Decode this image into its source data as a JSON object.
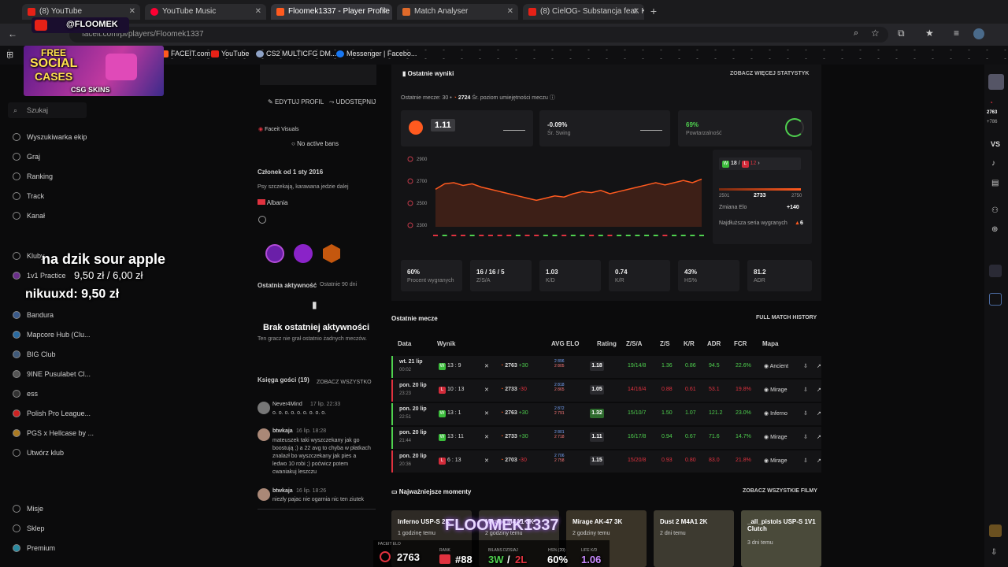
{
  "tabs": [
    {
      "label": "(8) YouTube",
      "icon": "youtube-icon"
    },
    {
      "label": "YouTube Music",
      "icon": "youtube-music-icon"
    },
    {
      "label": "Floomek1337 - Player Profile -",
      "icon": "faceit-icon"
    },
    {
      "label": "Match Analyser",
      "icon": "match-analyser-icon"
    },
    {
      "label": "(8) CielOG- Substancja feat. Ki",
      "icon": "youtube-icon"
    }
  ],
  "address": {
    "url": "faceit.com/pl/players/Floomek1337"
  },
  "bookmarks": [
    "FACEIT.com",
    "YouTube",
    "CS2 MULTICFG DM...",
    "Messenger | Facebo..."
  ],
  "overlay": {
    "channel": "@FLOOMEK",
    "ad_free": "FREE",
    "ad_social": "SOCIAL",
    "ad_cases": "CASES",
    "ad_brand": "CSG SKINS",
    "donation1_title": "na dzik sour apple",
    "donation1_amount": "9,50 zł / 6,00 zł",
    "donation2": "nikuuxd: 9,50 zł",
    "nick": "FLOOMEK1337",
    "bottom_labels": [
      "FACEIT ELO",
      "RANK",
      "BILANS DZISIAJ",
      "HS% (20)",
      "LIFE K/D"
    ],
    "bottom_values": [
      "2763",
      "#88",
      "3W",
      "2L",
      "60%",
      "1.06"
    ]
  },
  "leftnav": {
    "search": "Szukaj",
    "items": [
      "Wyszukiwarka ekip",
      "Graj",
      "Ranking",
      "Track",
      "Kanał",
      "Kluby",
      "1v1 Practice",
      "Bandura",
      "Mapcore Hub (Clu...",
      "BIG Club",
      "9INE Pusulabet Cl...",
      "ess",
      "Polish Pro League...",
      "PGS x Hellcase by ...",
      "Utwórz klub",
      "Misje",
      "Sklep",
      "Premium"
    ]
  },
  "profile": {
    "edit": "EDYTUJ PROFIL",
    "share": "UDOSTĘPNIJ",
    "visuals": "Faceit Visuals",
    "bans": "No active bans",
    "member": "Członek od 1 sty 2016",
    "bio": "Psy szczekają, karawana jedzie dalej",
    "country": "Albania",
    "activity_title": "Ostatnia aktywność",
    "activity_range": "Ostatnie 90 dni",
    "no_activity": "Brak ostatniej aktywności",
    "no_activity_sub": "Ten gracz nie grał ostatnio żadnych meczów.",
    "guestbook": "Księga gości (19)",
    "see_all": "ZOBACZ WSZYSTKO",
    "comments": [
      {
        "author": "Never4Mind",
        "date": "17 lip. 22:33",
        "text": "o. o. o. o. o. o. o. o. o."
      },
      {
        "author": "btwkaja",
        "date": "16 lip. 18:28",
        "text": "mateuszek taki wyszczekany jak go boostują ;) a 22 avg to chyba w płatkach znalazł bo wyszczekany jak pies a ledwo 10 robi ;) poćwicz potem cwaniakuj leszczu"
      },
      {
        "author": "btwkaja",
        "date": "16 lip. 18:26",
        "text": "niezły pajac nie ogarnia nic ten ziutek"
      }
    ]
  },
  "stats": {
    "title": "Ostatnie wyniki",
    "more": "ZOBACZ WIĘCEJ STATYSTYK",
    "subtitle": "Ostatnie mecze: 30 •",
    "skill_value": "2724",
    "skill_label": "Śr. poziom umiejętności meczu",
    "rating_value": "1.11",
    "swing_value": "-0.09%",
    "swing_label": "Śr. Swing",
    "repeat_value": "69%",
    "repeat_label": "Powtarzalność",
    "streak_w": "18",
    "streak_l": "12",
    "elo_min": "2501",
    "elo_cur": "2733",
    "elo_max": "2750",
    "elo_change_label": "Zmiana Elo",
    "elo_change": "+140",
    "longest_label": "Najdłuższa seria wygranych",
    "longest_value": "6",
    "kpis": [
      {
        "value": "60%",
        "label": "Procent wygranych"
      },
      {
        "value": "16 / 16 / 5",
        "label": "Z/S/A"
      },
      {
        "value": "1.03",
        "label": "K/D"
      },
      {
        "value": "0.74",
        "label": "K/R"
      },
      {
        "value": "43%",
        "label": "HS%"
      },
      {
        "value": "81.2",
        "label": "ADR"
      }
    ]
  },
  "chart_data": {
    "type": "line",
    "title": "",
    "y_ticks": [
      "2900",
      "2700",
      "2500",
      "2300"
    ],
    "ylim": [
      2300,
      2900
    ],
    "values": [
      2640,
      2690,
      2700,
      2675,
      2690,
      2660,
      2640,
      2620,
      2600,
      2580,
      2560,
      2540,
      2560,
      2580,
      2570,
      2600,
      2620,
      2610,
      2630,
      2600,
      2620,
      2640,
      2660,
      2680,
      2700,
      2680,
      2700,
      2720,
      2700,
      2733
    ],
    "results": [
      "L",
      "W",
      "L",
      "L",
      "W",
      "L",
      "L",
      "L",
      "L",
      "W",
      "L",
      "L",
      "W",
      "W",
      "L",
      "W",
      "W",
      "L",
      "W",
      "L",
      "W",
      "W",
      "W",
      "W",
      "W",
      "L",
      "W",
      "W",
      "W",
      "W"
    ]
  },
  "matches": {
    "title": "Ostatnie mecze",
    "history": "FULL MATCH HISTORY",
    "headers": [
      "Data",
      "Wynik",
      "AVG ELO",
      "Rating",
      "Z/S/A",
      "Z/S",
      "K/R",
      "ADR",
      "FCR",
      "Mapa"
    ],
    "rows": [
      {
        "date": "wt. 21 lip",
        "time": "00:02",
        "res": "W",
        "score": "13 : 9",
        "elo": "2763",
        "delta": "+30",
        "avg1": "2 896",
        "avg2": "2 805",
        "rating": "1.18",
        "zsa": "19/14/8",
        "zs": "1.36",
        "kr": "0.86",
        "adr": "94.5",
        "fcr": "22.6%",
        "map": "Ancient"
      },
      {
        "date": "pon. 20 lip",
        "time": "23:23",
        "res": "L",
        "score": "10 : 13",
        "elo": "2733",
        "delta": "-30",
        "avg1": "2 818",
        "avg2": "2 865",
        "rating": "1.05",
        "zsa": "14/16/4",
        "zs": "0.88",
        "kr": "0.61",
        "adr": "53.1",
        "fcr": "19.8%",
        "map": "Mirage"
      },
      {
        "date": "pon. 20 lip",
        "time": "22:51",
        "res": "W",
        "score": "13 : 1",
        "elo": "2763",
        "delta": "+30",
        "avg1": "2 872",
        "avg2": "2 791",
        "rating": "1.32",
        "zsa": "15/10/7",
        "zs": "1.50",
        "kr": "1.07",
        "adr": "121.2",
        "fcr": "23.0%",
        "map": "Inferno"
      },
      {
        "date": "pon. 20 lip",
        "time": "21:44",
        "res": "W",
        "score": "13 : 11",
        "elo": "2733",
        "delta": "+30",
        "avg1": "2 801",
        "avg2": "2 718",
        "rating": "1.11",
        "zsa": "16/17/8",
        "zs": "0.94",
        "kr": "0.67",
        "adr": "71.6",
        "fcr": "14.7%",
        "map": "Mirage"
      },
      {
        "date": "pon. 20 lip",
        "time": "20:36",
        "res": "L",
        "score": "6 : 13",
        "elo": "2703",
        "delta": "-30",
        "avg1": "2 706",
        "avg2": "2 758",
        "rating": "1.15",
        "zsa": "15/20/8",
        "zs": "0.93",
        "kr": "0.80",
        "adr": "83.0",
        "fcr": "21.8%",
        "map": "Mirage"
      }
    ]
  },
  "highlights": {
    "title": "Najważniejsze momenty",
    "more": "ZOBACZ WSZYSTKIE FILMY",
    "items": [
      {
        "title": "Inferno USP-S 2K",
        "when": "1 godzinę temu"
      },
      {
        "title": "Mirage M4A1 3K",
        "when": "2 godziny temu"
      },
      {
        "title": "Mirage AK-47 3K",
        "when": "2 godziny temu"
      },
      {
        "title": "Dust 2 M4A1 2K",
        "when": "2 dni temu"
      },
      {
        "title": "_all_pistols USP-S 1V1 Clutch",
        "when": "3 dni temu"
      }
    ]
  },
  "rightrail": {
    "elo": "2763",
    "elo_sub": "+786",
    "vs": "VS"
  },
  "colors": {
    "accent": "#ff5a1f",
    "win": "#4fd14f",
    "loss": "#e0323f"
  }
}
